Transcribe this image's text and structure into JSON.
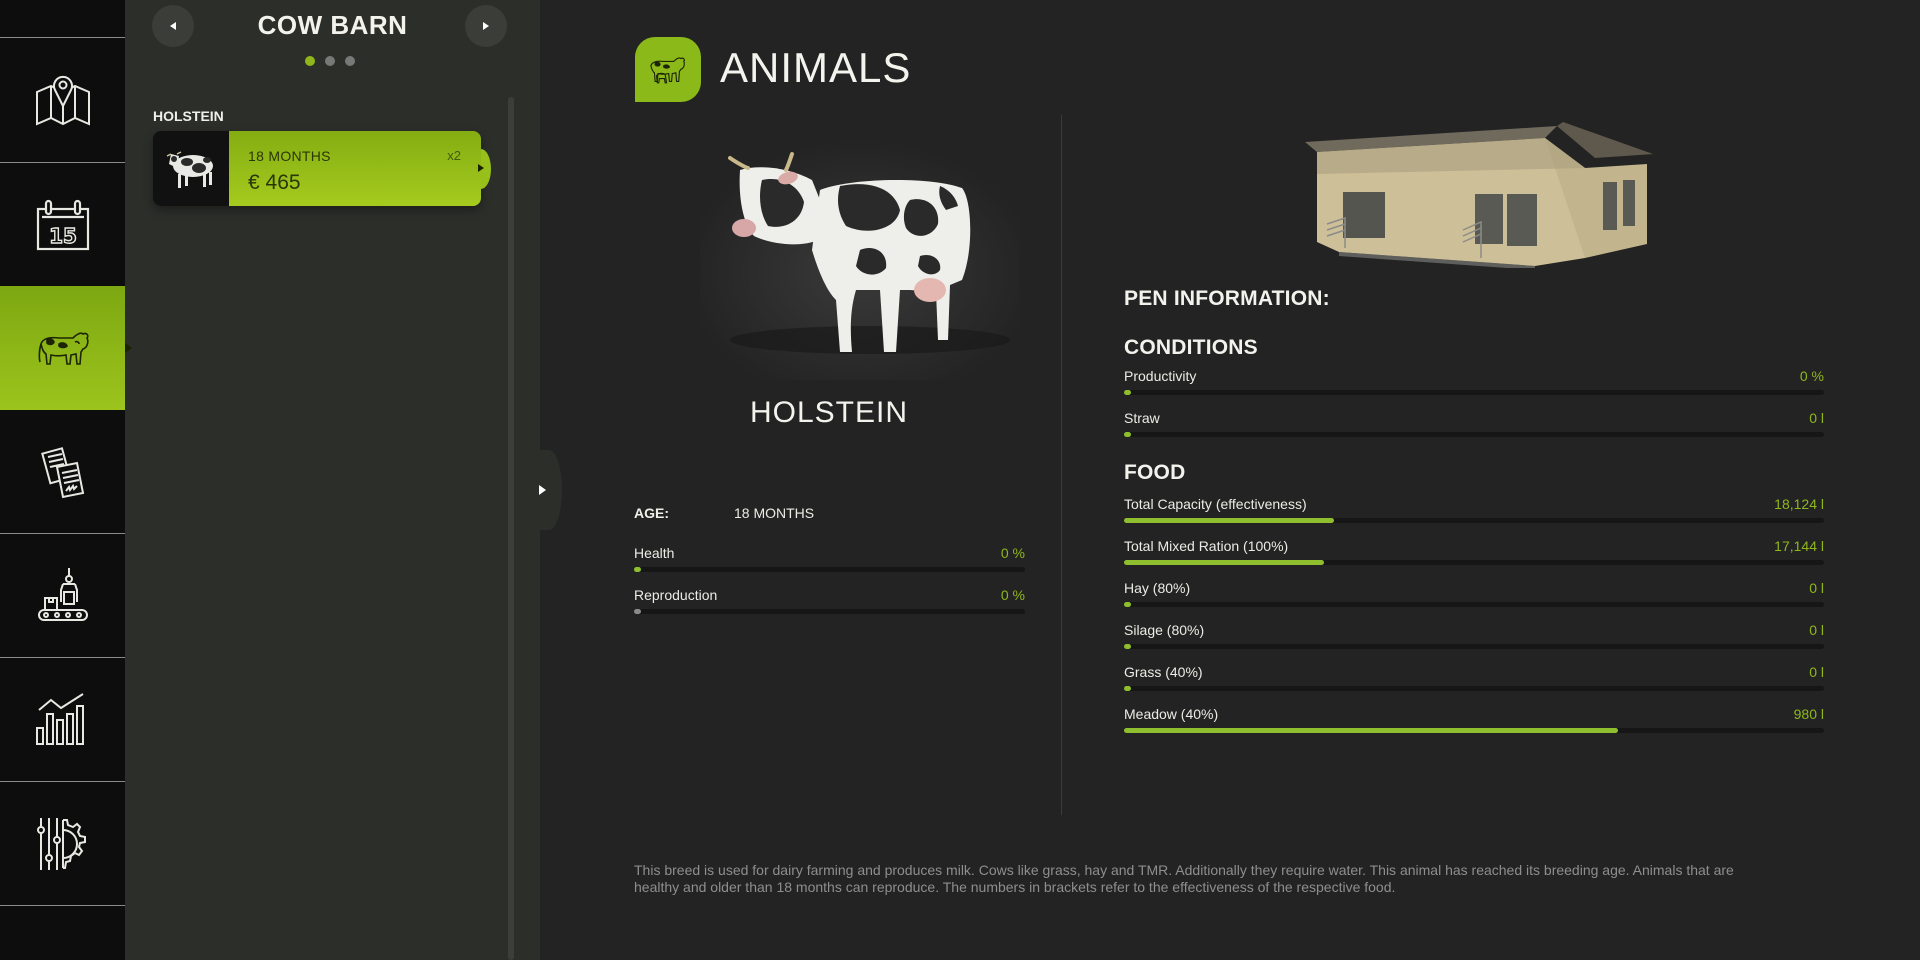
{
  "sidebar": {
    "items": [
      {
        "id": "map",
        "icon": "map-icon",
        "active": false
      },
      {
        "id": "calendar",
        "icon": "calendar-icon",
        "label": "15",
        "active": false
      },
      {
        "id": "animals",
        "icon": "cow-icon",
        "active": true
      },
      {
        "id": "contracts",
        "icon": "documents-icon",
        "active": false
      },
      {
        "id": "production",
        "icon": "production-icon",
        "active": false
      },
      {
        "id": "statistics",
        "icon": "chart-icon",
        "active": false
      },
      {
        "id": "settings",
        "icon": "settings-icon",
        "active": false
      }
    ]
  },
  "list_panel": {
    "title": "COW BARN",
    "prev_icon": "triangle-left-icon",
    "next_icon": "triangle-right-icon",
    "page_dots": 3,
    "active_dot": 0,
    "groups": [
      {
        "label": "HOLSTEIN",
        "animals": [
          {
            "age": "18 MONTHS",
            "price": "€ 465",
            "count": "x2",
            "selected": true
          }
        ]
      }
    ]
  },
  "main": {
    "title": "ANIMALS",
    "animal": {
      "breed": "HOLSTEIN",
      "age_label": "AGE:",
      "age_value": "18 MONTHS",
      "stats": [
        {
          "label": "Health",
          "value": "0 %",
          "fraction": 0.0,
          "color": "green"
        },
        {
          "label": "Reproduction",
          "value": "0 %",
          "fraction": 0.0,
          "color": "grey"
        }
      ]
    },
    "pen": {
      "heading": "PEN INFORMATION:",
      "conditions_heading": "CONDITIONS",
      "conditions": [
        {
          "label": "Productivity",
          "value": "0 %",
          "fraction": 0.0
        },
        {
          "label": "Straw",
          "value": "0 l",
          "fraction": 0.0
        }
      ],
      "food_heading": "FOOD",
      "food": [
        {
          "label": "Total Capacity (effectiveness)",
          "value": "18,124 l",
          "fraction": 0.3
        },
        {
          "label": "Total Mixed Ration (100%)",
          "value": "17,144 l",
          "fraction": 0.285
        },
        {
          "label": "Hay (80%)",
          "value": "0 l",
          "fraction": 0.0
        },
        {
          "label": "Silage (80%)",
          "value": "0 l",
          "fraction": 0.0
        },
        {
          "label": "Grass (40%)",
          "value": "0 l",
          "fraction": 0.0
        },
        {
          "label": "Meadow (40%)",
          "value": "980 l",
          "fraction": 0.705
        }
      ]
    },
    "description": "This breed is used for dairy farming and produces milk. Cows like grass, hay and TMR. Additionally they require water. This animal has reached its breeding age. Animals that are healthy and older than 18 months can reproduce. The numbers in brackets refer to the effectiveness of the respective food."
  },
  "colors": {
    "accent": "#8fb71b",
    "accent_light": "#a5cb1e",
    "sidebar_bg": "#0d0d0d",
    "panel_bg": "#2c2e2a",
    "main_bg": "#232323",
    "value_text": "#8fb71b",
    "muted_text": "#8e8e8e"
  }
}
